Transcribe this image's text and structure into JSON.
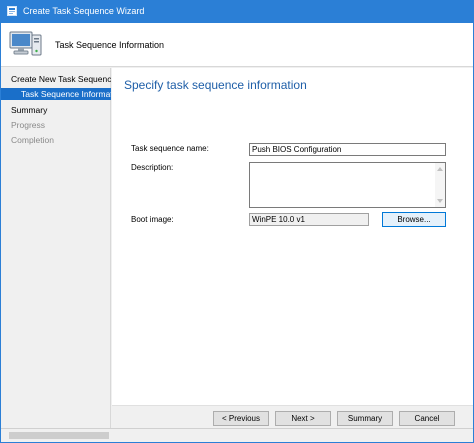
{
  "window": {
    "title": "Create Task Sequence Wizard",
    "accent_color": "#2b7fd6",
    "app_icon": "wizard-app-icon"
  },
  "header": {
    "title": "Task Sequence Information",
    "icon": "computer-icon"
  },
  "sidebar": {
    "items": [
      {
        "label": "Create New Task Sequence",
        "state": "normal"
      },
      {
        "label": "Task Sequence Informatio",
        "state": "selected"
      },
      {
        "label": "Summary",
        "state": "normal"
      },
      {
        "label": "Progress",
        "state": "disabled"
      },
      {
        "label": "Completion",
        "state": "disabled"
      }
    ]
  },
  "main": {
    "heading": "Specify task sequence information",
    "fields": {
      "name_label": "Task sequence name:",
      "name_value": "Push BIOS Configuration",
      "description_label": "Description:",
      "description_value": "",
      "boot_image_label": "Boot image:",
      "boot_image_value": "WinPE 10.0 v1",
      "browse_label": "Browse..."
    }
  },
  "footer": {
    "previous_label": "< Previous",
    "next_label": "Next >",
    "summary_label": "Summary",
    "cancel_label": "Cancel"
  }
}
